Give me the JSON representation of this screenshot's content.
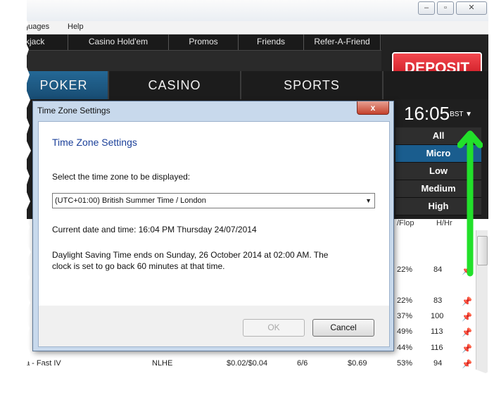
{
  "menu": {
    "languages": "guages",
    "help": "Help"
  },
  "nav": [
    "kjack",
    "Casino Hold'em",
    "Promos",
    "Friends",
    "Refer-A-Friend"
  ],
  "deposit_label": "DEPOSIT",
  "main_tabs": [
    "POKER",
    "CASINO",
    "SPORTS"
  ],
  "clock": {
    "time": "16:05",
    "zone": "BST ▼"
  },
  "filters": [
    "All",
    "Micro",
    "Low",
    "Medium",
    "High"
  ],
  "table": {
    "headers": {
      "flop": "/Flop",
      "hhr": "H/Hr"
    },
    "rows": [
      {
        "flop": "22%",
        "hhr": "84"
      },
      {
        "flop": "22%",
        "hhr": "83"
      },
      {
        "flop": "37%",
        "hhr": "100"
      },
      {
        "flop": "49%",
        "hhr": "113"
      },
      {
        "flop": "44%",
        "hhr": "116"
      },
      {
        "name": "a - Fast IV",
        "game": "NLHE",
        "stakes": "$0.02/$0.04",
        "seats": "6/6",
        "pot": "$0.69",
        "flop": "53%",
        "hhr": "94"
      }
    ]
  },
  "dialog": {
    "title": "Time Zone Settings",
    "close": "x",
    "heading": "Time Zone Settings",
    "select_label": "Select the time zone to be displayed:",
    "selected_zone": "(UTC+01:00) British Summer Time / London",
    "current": "Current date and time: 16:04 PM Thursday 24/07/2014",
    "dst_line1": "Daylight Saving Time ends on Sunday, 26 October 2014 at 02:00 AM. The",
    "dst_line2": "clock is set to go back 60 minutes at that time.",
    "ok": "OK",
    "cancel": "Cancel"
  },
  "colors": {
    "deposit": "#d8141e",
    "active_tab": "#1a5d8e",
    "heading": "#1a3f99",
    "arrow": "#22e02a"
  },
  "icons": {
    "pin": "pin-icon",
    "close": "close-icon",
    "caret": "chevron-down-icon"
  }
}
